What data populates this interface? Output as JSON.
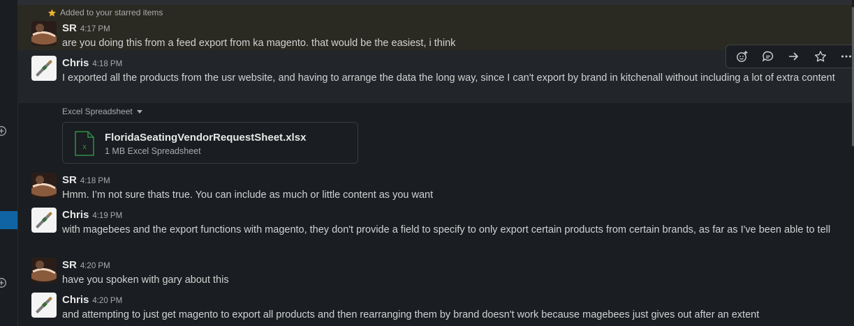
{
  "starred_notice": "Added to your starred items",
  "messages": [
    {
      "sender": "SR",
      "time": "4:17 PM",
      "text": "are you doing this from a feed export from ka magento. that would be the easiest, i think"
    },
    {
      "sender": "Chris",
      "time": "4:18 PM",
      "text": "I exported all the products from the usr website, and having to arrange the data the long way, since I can't export by brand in kitchenall without including a lot of extra content"
    },
    {
      "sender": "SR",
      "time": "4:18 PM",
      "text": "Hmm. I’m not sure thats true. You can include as much or little content as you want"
    },
    {
      "sender": "Chris",
      "time": "4:19 PM",
      "text": "with magebees and the export functions with magento, they don't provide a field to specify to only export certain products from certain brands, as far as I've been able to tell"
    },
    {
      "sender": "SR",
      "time": "4:20 PM",
      "text": "have you spoken with gary about this"
    },
    {
      "sender": "Chris",
      "time": "4:20 PM",
      "text": "and attempting to just get magento to export all products and then rearranging them by brand doesn't work because magebees just gives out after an extent"
    }
  ],
  "attachment": {
    "label": "Excel Spreadsheet",
    "file_name": "FloridaSeatingVendorRequestSheet.xlsx",
    "meta": "1 MB Excel Spreadsheet",
    "icon_letter": "x"
  },
  "toolbar_icons": [
    "add-reaction-icon",
    "reply-thread-icon",
    "share-icon",
    "star-icon",
    "more-actions-icon"
  ],
  "colors": {
    "background": "#1a1d21",
    "starred_highlight": "#2b2a22",
    "hover_highlight": "#222529",
    "accent_blue": "#1164a3",
    "star_yellow": "#e8b32e",
    "excel_green": "#2f8f46"
  }
}
